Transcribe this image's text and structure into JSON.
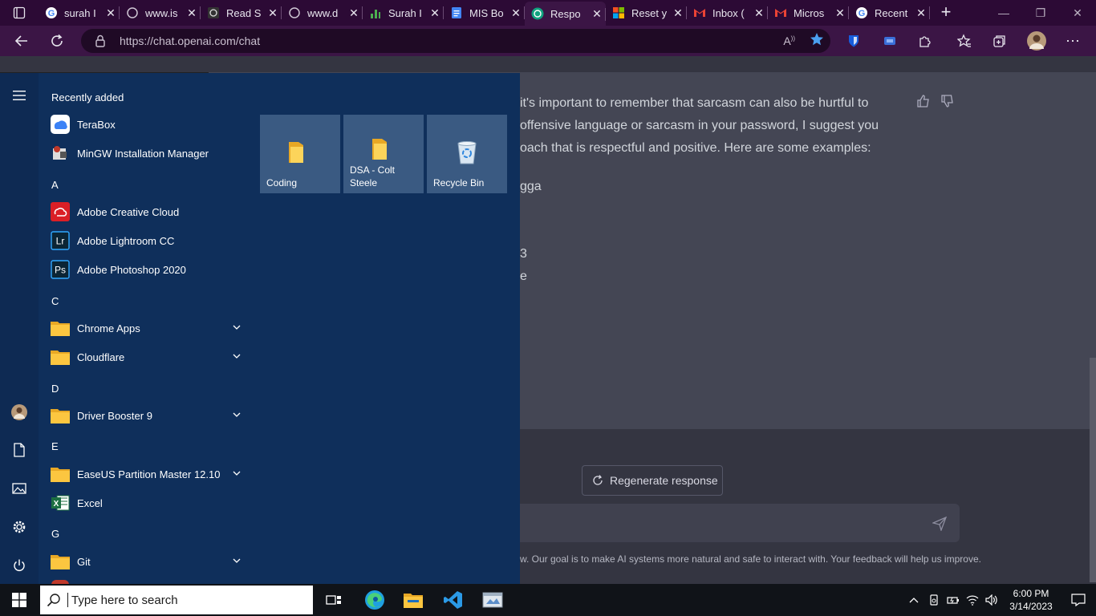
{
  "browser": {
    "tabs": [
      {
        "title": "surah I",
        "icon": "google-icon"
      },
      {
        "title": "www.is",
        "icon": "openai-icon"
      },
      {
        "title": "Read S",
        "icon": "read-icon"
      },
      {
        "title": "www.d",
        "icon": "openai-icon"
      },
      {
        "title": "Surah I",
        "icon": "chart-icon"
      },
      {
        "title": "MIS Bo",
        "icon": "docs-icon"
      },
      {
        "title": "Respo",
        "icon": "openai-icon",
        "active": true
      },
      {
        "title": "Reset y",
        "icon": "microsoft-icon"
      },
      {
        "title": "Inbox (",
        "icon": "gmail-icon"
      },
      {
        "title": "Micros",
        "icon": "gmail-icon"
      },
      {
        "title": "Recent",
        "icon": "google-icon"
      }
    ],
    "new_tab": "+",
    "url": "https://chat.openai.com/chat"
  },
  "chat": {
    "lines": [
      "it's important to remember that sarcasm can also be hurtful to",
      "offensive language or sarcasm in your password, I suggest you",
      "oach that is respectful and positive. Here are some examples:",
      "gga",
      "3",
      "e"
    ],
    "regenerate_label": "Regenerate response",
    "footer": "w. Our goal is to make AI systems more natural and safe to interact with. Your feedback will help us improve."
  },
  "start_menu": {
    "recently_added": "Recently added",
    "apps": [
      {
        "label": "TeraBox",
        "icon": "terabox-icon"
      },
      {
        "label": "MinGW Installation Manager",
        "icon": "mingw-icon"
      },
      {
        "label": "Adobe Creative Cloud",
        "icon": "creative-cloud-icon"
      },
      {
        "label": "Adobe Lightroom CC",
        "icon": "lightroom-icon",
        "badge": "Lr"
      },
      {
        "label": "Adobe Photoshop 2020",
        "icon": "photoshop-icon",
        "badge": "Ps"
      },
      {
        "label": "Chrome Apps",
        "icon": "folder-icon"
      },
      {
        "label": "Cloudflare",
        "icon": "folder-icon"
      },
      {
        "label": "Driver Booster 9",
        "icon": "folder-icon"
      },
      {
        "label": "EaseUS Partition Master 12.10",
        "icon": "folder-icon"
      },
      {
        "label": "Excel",
        "icon": "excel-icon"
      },
      {
        "label": "Git",
        "icon": "folder-icon"
      }
    ],
    "letters": [
      "A",
      "C",
      "D",
      "E",
      "G"
    ],
    "tiles": [
      {
        "label": "Coding",
        "icon": "folder-icon"
      },
      {
        "label": "DSA - Colt Steele",
        "icon": "folder-icon"
      },
      {
        "label": "Recycle Bin",
        "icon": "recycle-bin-icon"
      }
    ]
  },
  "taskbar": {
    "search_placeholder": "Type here to search",
    "time": "6:00 PM",
    "date": "3/14/2023"
  }
}
